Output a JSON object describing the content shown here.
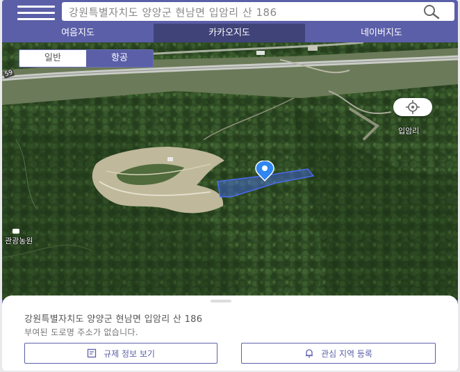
{
  "search": {
    "value": "강원특별자치도 양양군 현남면 입암리 산 186",
    "placeholder": ""
  },
  "tabs": [
    {
      "label": "여음지도",
      "active": false
    },
    {
      "label": "카카오지도",
      "active": true
    },
    {
      "label": "네이버지도",
      "active": false
    }
  ],
  "map": {
    "type_toggle": {
      "normal": "일반",
      "satellite": "항공",
      "selected": "항공"
    },
    "labels": {
      "village": "입암리",
      "farm": "관광농원",
      "road": "59"
    },
    "icons": {
      "marker": "location-pin-icon",
      "locate": "crosshair-icon"
    }
  },
  "sheet": {
    "address": "강원특별자치도 양양군 현남면 입암리 산 186",
    "note": "부여된 도로명 주소가 없습니다.",
    "regulation_button": "규제 정보 보기",
    "watch_button": "관심 지역 등록"
  },
  "colors": {
    "accent": "#5b5fa8",
    "accent_dark": "#3f4378",
    "parcel": "#4a6cf0"
  }
}
